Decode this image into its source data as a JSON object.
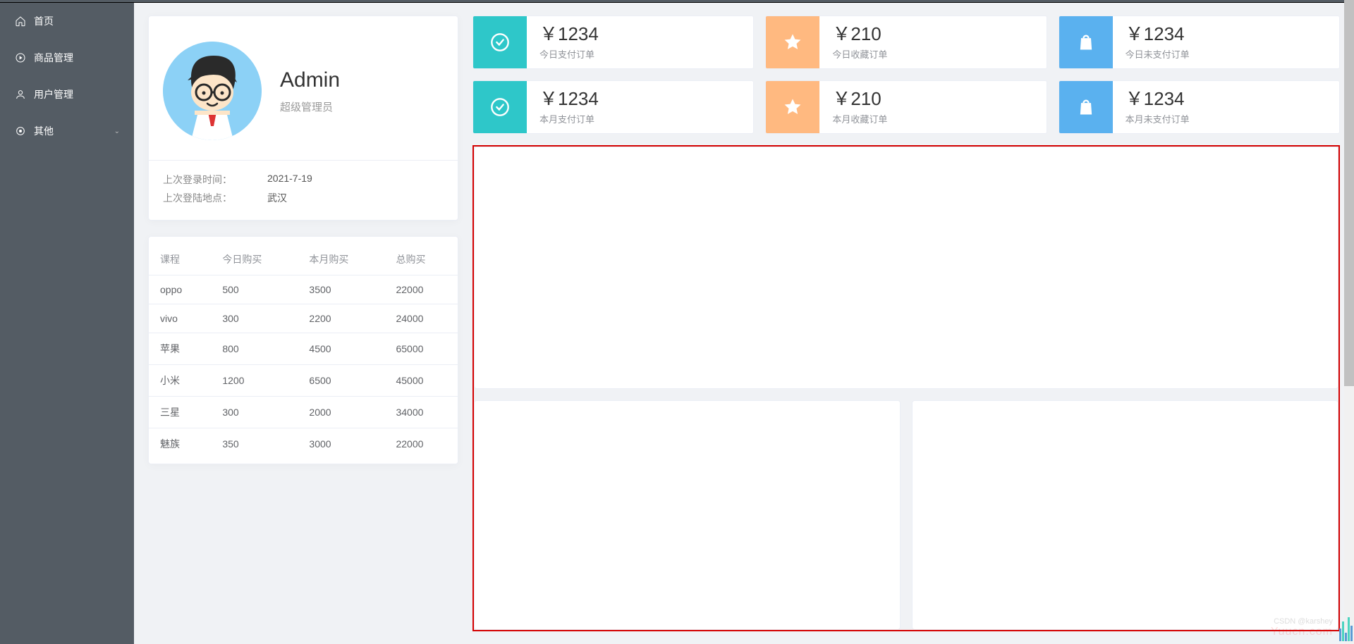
{
  "sidebar": {
    "items": [
      {
        "label": "首页",
        "icon": "home"
      },
      {
        "label": "商品管理",
        "icon": "play"
      },
      {
        "label": "用户管理",
        "icon": "user"
      },
      {
        "label": "其他",
        "icon": "location",
        "hasChildren": true
      }
    ]
  },
  "user": {
    "name": "Admin",
    "role": "超级管理员",
    "lastLoginTimeLabel": "上次登录时间：",
    "lastLoginTime": "2021-7-19",
    "lastLoginPlaceLabel": "上次登陆地点：",
    "lastLoginPlace": "武汉"
  },
  "table": {
    "headers": [
      "课程",
      "今日购买",
      "本月购买",
      "总购买"
    ],
    "rows": [
      [
        "oppo",
        "500",
        "3500",
        "22000"
      ],
      [
        "vivo",
        "300",
        "2200",
        "24000"
      ],
      [
        "苹果",
        "800",
        "4500",
        "65000"
      ],
      [
        "小米",
        "1200",
        "6500",
        "45000"
      ],
      [
        "三星",
        "300",
        "2000",
        "34000"
      ],
      [
        "魅族",
        "350",
        "3000",
        "22000"
      ]
    ]
  },
  "stats": [
    {
      "value": "￥1234",
      "label": "今日支付订单",
      "color": "teal",
      "icon": "check"
    },
    {
      "value": "￥210",
      "label": "今日收藏订单",
      "color": "orange",
      "icon": "star"
    },
    {
      "value": "￥1234",
      "label": "今日未支付订单",
      "color": "blue",
      "icon": "bag"
    },
    {
      "value": "￥1234",
      "label": "本月支付订单",
      "color": "teal",
      "icon": "check"
    },
    {
      "value": "￥210",
      "label": "本月收藏订单",
      "color": "orange",
      "icon": "star"
    },
    {
      "value": "￥1234",
      "label": "本月未支付订单",
      "color": "blue",
      "icon": "bag"
    }
  ],
  "watermark": {
    "site": "Yuucn.com",
    "credit": "CSDN @karshey"
  }
}
